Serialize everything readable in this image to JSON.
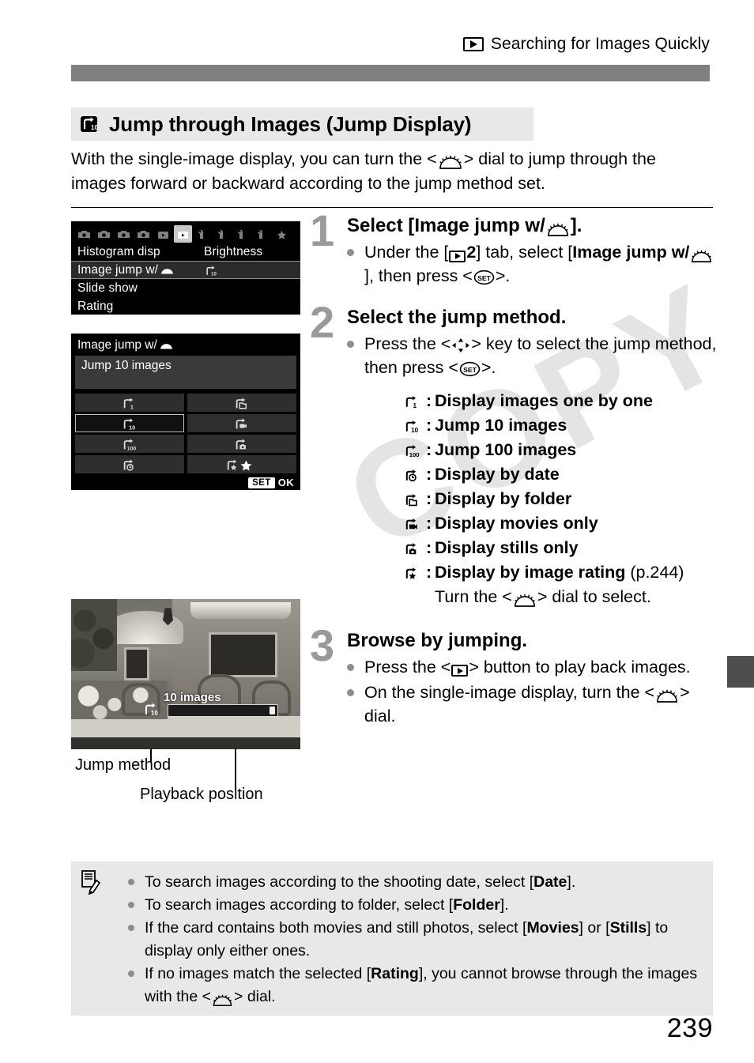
{
  "header": {
    "chapter_icon": "playback-icon",
    "title": "Searching for Images Quickly"
  },
  "section": {
    "icon": "jump-10-icon",
    "title": "Jump through Images (Jump Display)",
    "intro_a": "With the single-image display, you can turn the <",
    "intro_dial": "main-dial-icon",
    "intro_b": "> dial to jump through the images forward or backward according to the jump method set."
  },
  "menu_screen": {
    "tabs": [
      {
        "name": "shoot1",
        "selected": false
      },
      {
        "name": "shoot2",
        "selected": false
      },
      {
        "name": "shoot3",
        "selected": false
      },
      {
        "name": "shoot4",
        "selected": false
      },
      {
        "name": "playback1",
        "selected": false
      },
      {
        "name": "playback2",
        "selected": true
      },
      {
        "name": "setup1",
        "selected": false
      },
      {
        "name": "setup2",
        "selected": false
      },
      {
        "name": "setup3",
        "selected": false
      },
      {
        "name": "setup4",
        "selected": false
      },
      {
        "name": "mymenu",
        "selected": false
      }
    ],
    "rows": [
      {
        "label": "Histogram disp",
        "value": "Brightness",
        "value_icon": "",
        "highlighted": false
      },
      {
        "label": "Image jump w/",
        "label_icon": "main-dial-icon",
        "value": "",
        "value_icon": "jump-10-icon",
        "highlighted": true
      },
      {
        "label": "Slide show",
        "value": "",
        "value_icon": "",
        "highlighted": false
      },
      {
        "label": "Rating",
        "value": "",
        "value_icon": "",
        "highlighted": false
      }
    ]
  },
  "jump_screen": {
    "title": "Image jump w/",
    "title_icon": "main-dial-icon",
    "current": "Jump 10 images",
    "options": [
      {
        "icon": "jump-1-icon",
        "label": "1",
        "selected": false
      },
      {
        "icon": "jump-folder-icon",
        "label": "folder",
        "selected": false
      },
      {
        "icon": "jump-10-icon",
        "label": "10",
        "selected": true
      },
      {
        "icon": "jump-movies-icon",
        "label": "movies",
        "selected": false
      },
      {
        "icon": "jump-100-icon",
        "label": "100",
        "selected": false
      },
      {
        "icon": "jump-stills-icon",
        "label": "stills",
        "selected": false
      },
      {
        "icon": "jump-date-icon",
        "label": "date",
        "selected": false
      },
      {
        "icon": "jump-rating-icon",
        "label": "rating",
        "selected": false
      }
    ],
    "confirm_key": "SET",
    "confirm_label": "OK"
  },
  "photo": {
    "overlay_label": "10 images",
    "overlay_icon": "jump-10-icon",
    "caption_jump_method": "Jump method",
    "caption_playback_position": "Playback position"
  },
  "steps": [
    {
      "number": "1",
      "heading_a": "Select [Image jump w/",
      "heading_icon": "main-dial-icon",
      "heading_b": "].",
      "bullets": [
        {
          "parts": [
            "Under the [",
            "PB-ICON",
            "2] tab, select [",
            "Image jump w/",
            "DIAL-ICON",
            "], then press <",
            "SET-ICON",
            ">."
          ]
        }
      ]
    },
    {
      "number": "2",
      "heading": "Select the jump method.",
      "bullets": [
        {
          "parts": [
            "Press the <",
            "MULTI-ICON",
            "> key to select the jump method, then press <",
            "SET-ICON",
            ">."
          ]
        }
      ],
      "legend": [
        {
          "icon": "jump-1-icon",
          "text": "Display images one by one",
          "page": ""
        },
        {
          "icon": "jump-10-icon",
          "text": "Jump 10 images",
          "page": ""
        },
        {
          "icon": "jump-100-icon",
          "text": "Jump 100 images",
          "page": ""
        },
        {
          "icon": "jump-date-icon",
          "text": "Display by date",
          "page": ""
        },
        {
          "icon": "jump-folder-icon",
          "text": "Display by folder",
          "page": ""
        },
        {
          "icon": "jump-movies-icon",
          "text": "Display movies only",
          "page": ""
        },
        {
          "icon": "jump-stills-icon",
          "text": "Display stills only",
          "page": ""
        },
        {
          "icon": "jump-rating-icon",
          "text": "Display by image rating",
          "page": "(p.244)"
        }
      ],
      "legend_sub_a": "Turn the <",
      "legend_sub_icon": "main-dial-icon",
      "legend_sub_b": "> dial to select."
    },
    {
      "number": "3",
      "heading": "Browse by jumping.",
      "bullets": [
        {
          "parts": [
            "Press the <",
            "PB-ICON",
            "> button to play back images."
          ]
        },
        {
          "parts": [
            "On the single-image display, turn the <",
            "DIAL-ICON",
            "> dial."
          ]
        }
      ]
    }
  ],
  "note": {
    "icon": "note-pencil-icon",
    "items": [
      {
        "parts": [
          "To search images according to the shooting date, select [",
          "Date",
          "]."
        ]
      },
      {
        "parts": [
          "To search images according to folder, select [",
          "Folder",
          "]."
        ]
      },
      {
        "parts": [
          "If the card contains both movies and still photos, select [",
          "Movies",
          "] or [",
          "Stills",
          "] to display only either ones."
        ]
      },
      {
        "parts": [
          "If no images match the selected [",
          "Rating",
          "], you cannot browse through the images with the <",
          "DIAL-ICON",
          "> dial."
        ]
      }
    ]
  },
  "watermark": "COPY",
  "page_number": "239",
  "colors": {
    "rule": "#808080",
    "title_bar": "#e8e8e8",
    "note_bg": "#e8e8e8",
    "step_number": "#9a9a9a",
    "bullet": "#8d8d8d",
    "edge_tab": "#4d4d4d",
    "watermark": "#e4e4e4"
  }
}
